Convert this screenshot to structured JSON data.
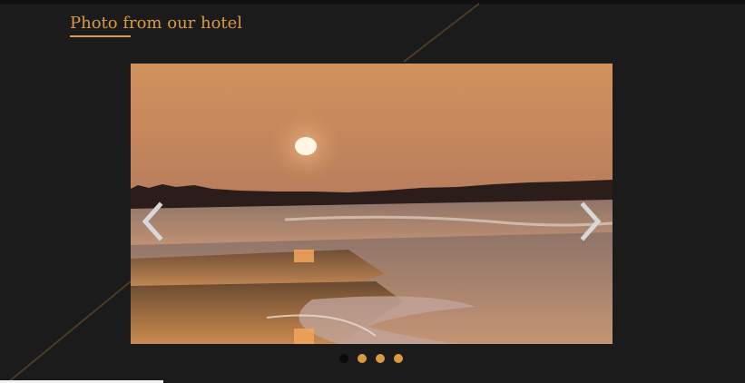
{
  "section": {
    "title": "Photo from our hotel"
  },
  "carousel": {
    "slide_alt": "Sunset over the beach",
    "prev_icon": "chevron-left-icon",
    "next_icon": "chevron-right-icon",
    "slide_count": 4,
    "active_index": 0
  },
  "colors": {
    "accent": "#d99a45",
    "background": "#1b1b1b",
    "dot_active": "#0a0a0a",
    "dot_inactive": "#d99a45"
  }
}
